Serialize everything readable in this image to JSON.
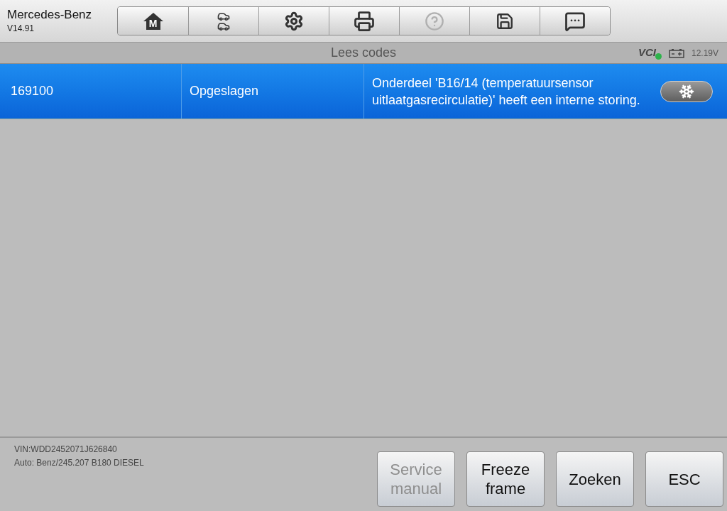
{
  "header": {
    "title": "Mercedes-Benz",
    "version": "V14.91"
  },
  "toolbar": [
    {
      "kind": "home",
      "glyph": "M",
      "disabled": false
    },
    {
      "kind": "vehicle",
      "disabled": false
    },
    {
      "kind": "settings",
      "disabled": false
    },
    {
      "kind": "print",
      "disabled": false
    },
    {
      "kind": "help",
      "disabled": true
    },
    {
      "kind": "save",
      "disabled": false
    },
    {
      "kind": "message",
      "disabled": false
    }
  ],
  "title_bar": {
    "title": "Lees codes",
    "vci": "VCI",
    "vci_connected": true,
    "voltage": "12.19V"
  },
  "codes": [
    {
      "code": "169100",
      "status": "Opgeslagen",
      "description": "Onderdeel 'B16/14 (temperatuursensor uitlaatgasrecirculatie)' heeft een interne storing.",
      "selected": true
    }
  ],
  "footer": {
    "vin": "VIN:WDD2452071J626840",
    "vehicle": "Auto: Benz/245.207 B180 DIESEL",
    "buttons": [
      {
        "label": "Service manual",
        "disabled": true
      },
      {
        "label": "Freeze frame",
        "disabled": false
      },
      {
        "label": "Zoeken",
        "disabled": false
      },
      {
        "label": "ESC",
        "disabled": false
      }
    ]
  }
}
